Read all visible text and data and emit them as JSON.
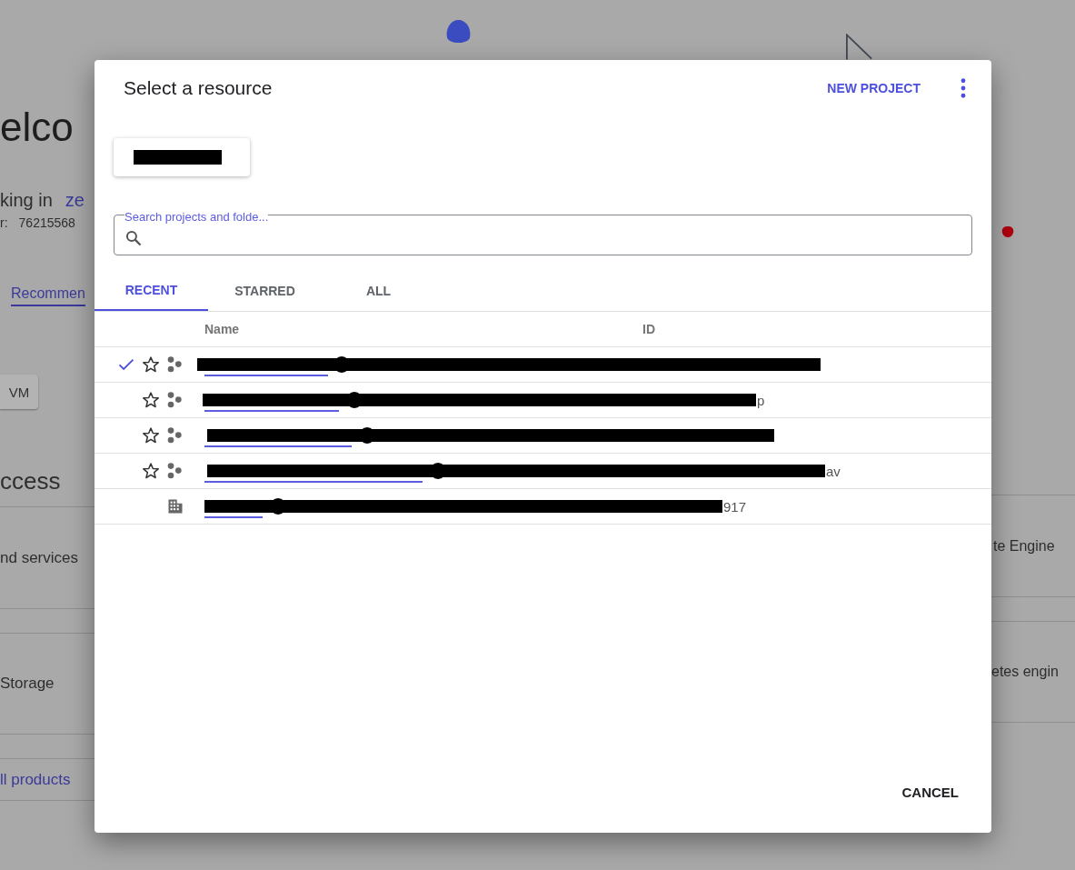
{
  "background": {
    "heading": "elco",
    "working_in": "king in",
    "project_link": "ze",
    "number_label": "r:",
    "number": "76215568",
    "recommendations_link": "Recommen",
    "button": "VM",
    "section_title": "ccess",
    "left_items": [
      "nd services",
      "Storage"
    ],
    "all_products_link": "ll products",
    "right_items": [
      "te Engine",
      "etes engin"
    ]
  },
  "dialog": {
    "title": "Select a resource",
    "new_project": "NEW PROJECT",
    "search": {
      "label": "Search projects and folde..."
    },
    "tabs": [
      {
        "label": "RECENT",
        "selected": true
      },
      {
        "label": "STARRED",
        "selected": false
      },
      {
        "label": "ALL",
        "selected": false
      }
    ],
    "columns": [
      "Name",
      "ID"
    ],
    "rows": [
      {
        "kind": "project",
        "selected": true,
        "starred": false
      },
      {
        "kind": "project",
        "selected": false,
        "starred": false,
        "id_fragment": "p"
      },
      {
        "kind": "project",
        "selected": false,
        "starred": false
      },
      {
        "kind": "project",
        "selected": false,
        "starred": false,
        "id_fragment": "av"
      },
      {
        "kind": "organization",
        "selected": false,
        "id_fragment": "917"
      }
    ],
    "cancel": "CANCEL"
  }
}
